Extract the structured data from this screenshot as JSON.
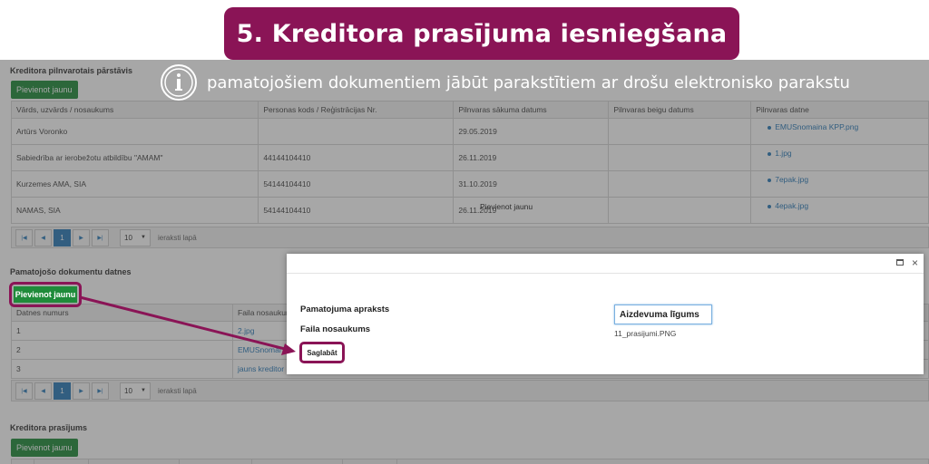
{
  "banner": {
    "title": "5. Kreditora prasījuma iesniegšana"
  },
  "info": {
    "text": "pamatojošiem dokumentiem jābūt parakstītiem ar drošu elektronisko parakstu"
  },
  "colors": {
    "brand": "#8a1456",
    "green": "#1f8b3a",
    "link": "#2a7ab8"
  },
  "section1": {
    "title": "Kreditora pilnvarotais pārstāvis",
    "add_label": "Pievienot jaunu",
    "headers": [
      "Vārds, uzvārds / nosaukums",
      "Personas kods / Reģistrācijas Nr.",
      "Pilnvaras sākuma datums",
      "Pilnvaras beigu datums",
      "Pilnvaras datne"
    ],
    "rows": [
      [
        "Artūrs Voronko",
        "",
        "29.05.2019",
        "",
        "EMUSnomaina KPP.png"
      ],
      [
        "Sabiedrība ar ierobežotu atbildību \"AMAM\"",
        "44144104410",
        "26.11.2019",
        "",
        "1.jpg"
      ],
      [
        "Kurzemes AMA, SIA",
        "54144104410",
        "31.10.2019",
        "",
        "7epak.jpg"
      ],
      [
        "NAMAS, SIA",
        "54144104410",
        "26.11.2019",
        "",
        "4epak.jpg"
      ]
    ],
    "floating_label": "Pievienot jaunu",
    "pager": {
      "page": "1",
      "size": "10",
      "label": "ieraksti lapā"
    }
  },
  "section2": {
    "title": "Pamatojošo dokumentu datnes",
    "add_label": "Pievienot jaunu",
    "headers": [
      "Datnes numurs",
      "Faila nosaukum"
    ],
    "rows": [
      [
        "1",
        "2.jpg"
      ],
      [
        "2",
        "EMUSnomai"
      ],
      [
        "3",
        "jauns kreditor"
      ]
    ],
    "pager": {
      "page": "1",
      "size": "10",
      "label": "ieraksti lapā"
    }
  },
  "section3": {
    "title": "Kreditora prasījums",
    "add_label": "Pievienot jaunu"
  },
  "modal": {
    "label_description": "Pamatojuma apraksts",
    "label_filename": "Faila nosaukums",
    "description_value": "Aizdevuma līgums",
    "file_value": "11_prasijumi.PNG",
    "save_label": "Saglabāt",
    "close_glyph": "×"
  },
  "pager_icons": {
    "first": "|◀",
    "prev": "◀",
    "next": "▶",
    "last": "▶|",
    "dropdown": "▼"
  }
}
